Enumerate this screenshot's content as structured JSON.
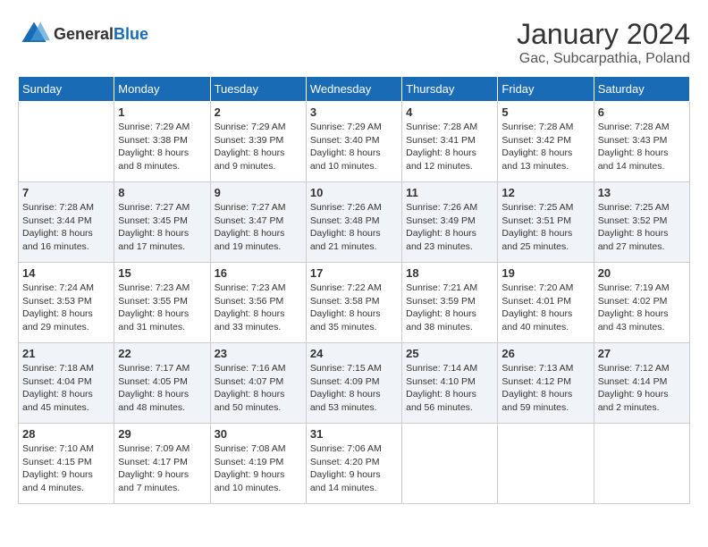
{
  "header": {
    "logo": {
      "general": "General",
      "blue": "Blue"
    },
    "title": "January 2024",
    "subtitle": "Gac, Subcarpathia, Poland"
  },
  "calendar": {
    "days_of_week": [
      "Sunday",
      "Monday",
      "Tuesday",
      "Wednesday",
      "Thursday",
      "Friday",
      "Saturday"
    ],
    "weeks": [
      [
        {
          "day": "",
          "info": ""
        },
        {
          "day": "1",
          "info": "Sunrise: 7:29 AM\nSunset: 3:38 PM\nDaylight: 8 hours\nand 8 minutes."
        },
        {
          "day": "2",
          "info": "Sunrise: 7:29 AM\nSunset: 3:39 PM\nDaylight: 8 hours\nand 9 minutes."
        },
        {
          "day": "3",
          "info": "Sunrise: 7:29 AM\nSunset: 3:40 PM\nDaylight: 8 hours\nand 10 minutes."
        },
        {
          "day": "4",
          "info": "Sunrise: 7:28 AM\nSunset: 3:41 PM\nDaylight: 8 hours\nand 12 minutes."
        },
        {
          "day": "5",
          "info": "Sunrise: 7:28 AM\nSunset: 3:42 PM\nDaylight: 8 hours\nand 13 minutes."
        },
        {
          "day": "6",
          "info": "Sunrise: 7:28 AM\nSunset: 3:43 PM\nDaylight: 8 hours\nand 14 minutes."
        }
      ],
      [
        {
          "day": "7",
          "info": "Sunrise: 7:28 AM\nSunset: 3:44 PM\nDaylight: 8 hours\nand 16 minutes."
        },
        {
          "day": "8",
          "info": "Sunrise: 7:27 AM\nSunset: 3:45 PM\nDaylight: 8 hours\nand 17 minutes."
        },
        {
          "day": "9",
          "info": "Sunrise: 7:27 AM\nSunset: 3:47 PM\nDaylight: 8 hours\nand 19 minutes."
        },
        {
          "day": "10",
          "info": "Sunrise: 7:26 AM\nSunset: 3:48 PM\nDaylight: 8 hours\nand 21 minutes."
        },
        {
          "day": "11",
          "info": "Sunrise: 7:26 AM\nSunset: 3:49 PM\nDaylight: 8 hours\nand 23 minutes."
        },
        {
          "day": "12",
          "info": "Sunrise: 7:25 AM\nSunset: 3:51 PM\nDaylight: 8 hours\nand 25 minutes."
        },
        {
          "day": "13",
          "info": "Sunrise: 7:25 AM\nSunset: 3:52 PM\nDaylight: 8 hours\nand 27 minutes."
        }
      ],
      [
        {
          "day": "14",
          "info": "Sunrise: 7:24 AM\nSunset: 3:53 PM\nDaylight: 8 hours\nand 29 minutes."
        },
        {
          "day": "15",
          "info": "Sunrise: 7:23 AM\nSunset: 3:55 PM\nDaylight: 8 hours\nand 31 minutes."
        },
        {
          "day": "16",
          "info": "Sunrise: 7:23 AM\nSunset: 3:56 PM\nDaylight: 8 hours\nand 33 minutes."
        },
        {
          "day": "17",
          "info": "Sunrise: 7:22 AM\nSunset: 3:58 PM\nDaylight: 8 hours\nand 35 minutes."
        },
        {
          "day": "18",
          "info": "Sunrise: 7:21 AM\nSunset: 3:59 PM\nDaylight: 8 hours\nand 38 minutes."
        },
        {
          "day": "19",
          "info": "Sunrise: 7:20 AM\nSunset: 4:01 PM\nDaylight: 8 hours\nand 40 minutes."
        },
        {
          "day": "20",
          "info": "Sunrise: 7:19 AM\nSunset: 4:02 PM\nDaylight: 8 hours\nand 43 minutes."
        }
      ],
      [
        {
          "day": "21",
          "info": "Sunrise: 7:18 AM\nSunset: 4:04 PM\nDaylight: 8 hours\nand 45 minutes."
        },
        {
          "day": "22",
          "info": "Sunrise: 7:17 AM\nSunset: 4:05 PM\nDaylight: 8 hours\nand 48 minutes."
        },
        {
          "day": "23",
          "info": "Sunrise: 7:16 AM\nSunset: 4:07 PM\nDaylight: 8 hours\nand 50 minutes."
        },
        {
          "day": "24",
          "info": "Sunrise: 7:15 AM\nSunset: 4:09 PM\nDaylight: 8 hours\nand 53 minutes."
        },
        {
          "day": "25",
          "info": "Sunrise: 7:14 AM\nSunset: 4:10 PM\nDaylight: 8 hours\nand 56 minutes."
        },
        {
          "day": "26",
          "info": "Sunrise: 7:13 AM\nSunset: 4:12 PM\nDaylight: 8 hours\nand 59 minutes."
        },
        {
          "day": "27",
          "info": "Sunrise: 7:12 AM\nSunset: 4:14 PM\nDaylight: 9 hours\nand 2 minutes."
        }
      ],
      [
        {
          "day": "28",
          "info": "Sunrise: 7:10 AM\nSunset: 4:15 PM\nDaylight: 9 hours\nand 4 minutes."
        },
        {
          "day": "29",
          "info": "Sunrise: 7:09 AM\nSunset: 4:17 PM\nDaylight: 9 hours\nand 7 minutes."
        },
        {
          "day": "30",
          "info": "Sunrise: 7:08 AM\nSunset: 4:19 PM\nDaylight: 9 hours\nand 10 minutes."
        },
        {
          "day": "31",
          "info": "Sunrise: 7:06 AM\nSunset: 4:20 PM\nDaylight: 9 hours\nand 14 minutes."
        },
        {
          "day": "",
          "info": ""
        },
        {
          "day": "",
          "info": ""
        },
        {
          "day": "",
          "info": ""
        }
      ]
    ]
  }
}
